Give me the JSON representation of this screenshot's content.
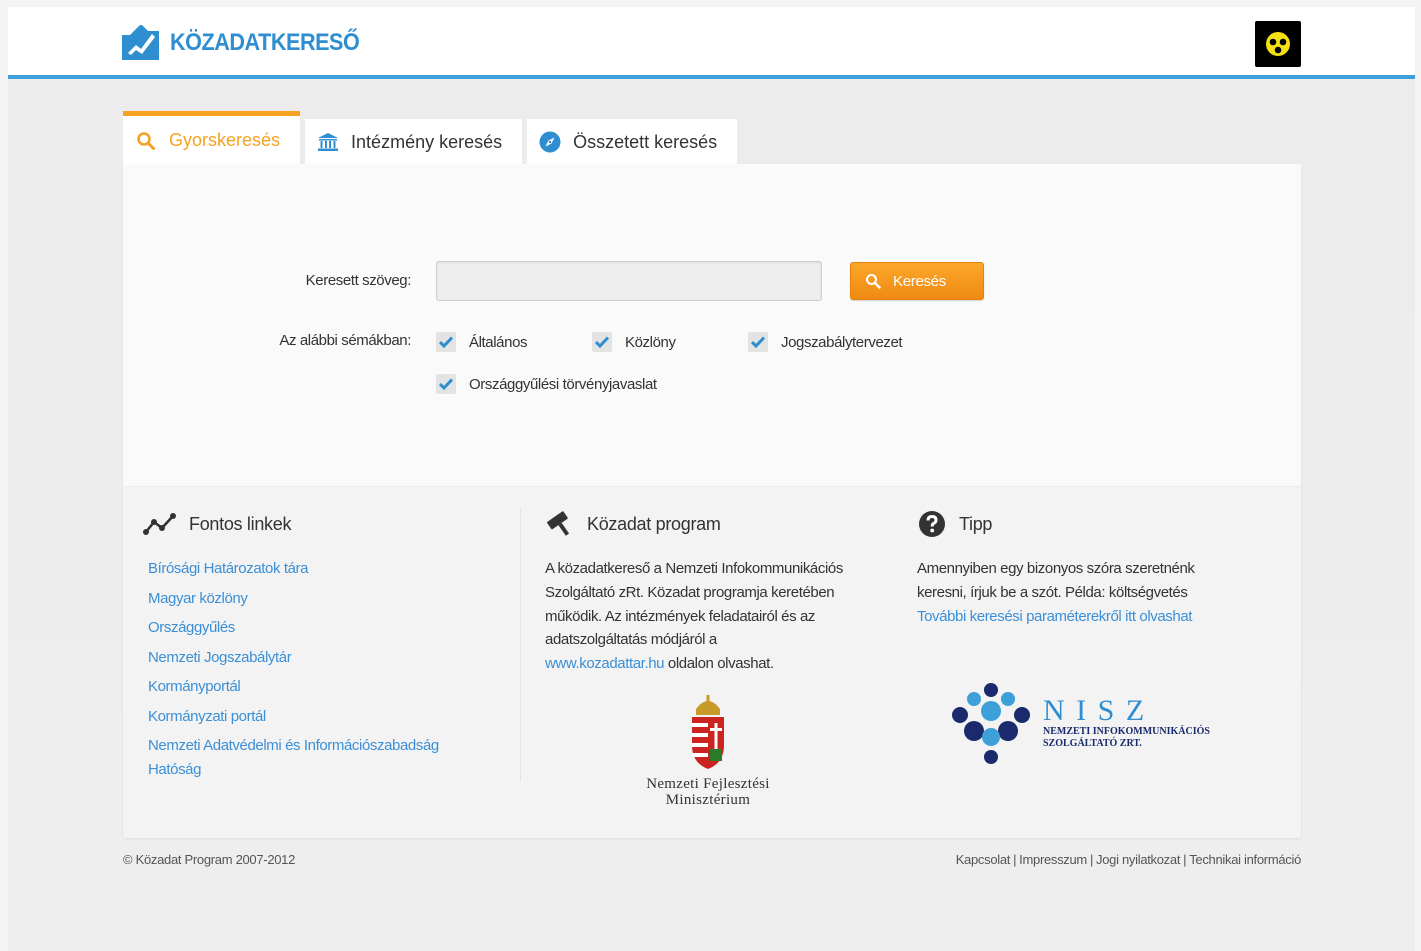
{
  "header": {
    "logo_text": "KÖZADATKERESŐ",
    "accessibility_icon": "low-vision-icon"
  },
  "tabs": [
    {
      "label": "Gyorskeresés",
      "icon": "search-icon",
      "active": true
    },
    {
      "label": "Intézmény keresés",
      "icon": "institution-icon",
      "active": false
    },
    {
      "label": "Összetett keresés",
      "icon": "compass-icon",
      "active": false
    }
  ],
  "search": {
    "text_label": "Keresett szöveg:",
    "input_value": "",
    "button_label": "Keresés",
    "schema_label": "Az alábbi sémákban:",
    "schemas": [
      {
        "label": "Általános",
        "checked": true
      },
      {
        "label": "Közlöny",
        "checked": true
      },
      {
        "label": "Jogszabálytervezet",
        "checked": true
      },
      {
        "label": "Országgyűlési törvényjavaslat",
        "checked": true
      }
    ]
  },
  "links_col": {
    "title": "Fontos linkek",
    "links": [
      "Bírósági Határozatok tára",
      "Magyar közlöny",
      "Országgyűlés",
      "Nemzeti Jogszabálytár",
      "Kormányportál",
      "Kormányzati portál",
      "Nemzeti Adatvédelmi és Információszabadság Hatóság"
    ]
  },
  "program_col": {
    "title": "Közadat program",
    "text": "A közadatkereső a Nemzeti Infokommunikációs Szolgáltató zRt. Közadat programja keretében működik. Az intézmények feladatairól és az adatszolgáltatás módjáról a",
    "link": "www.kozadattar.hu",
    "text_after": "oldalon olvashat.",
    "ministry_line1": "Nemzeti Fejlesztési",
    "ministry_line2": "Minisztérium"
  },
  "tip_col": {
    "title": "Tipp",
    "text": "Amennyiben egy bizonyos szóra szeretnénk keresni, írjuk be a szót. Példa: költségvetés",
    "link": "További keresési paraméterekről itt olvashat",
    "nisz_title": "N I S Z",
    "nisz_line1": "NEMZETI INFOKOMMUNIKÁCIÓS",
    "nisz_line2": "SZOLGÁLTATÓ ZRT."
  },
  "footer": {
    "copyright": "© Közadat Program 2007-2012",
    "links": [
      "Kapcsolat",
      "Impresszum",
      "Jogi nyilatkozat",
      "Technikai információ"
    ]
  },
  "colors": {
    "brand_blue": "#2e8ed0",
    "accent_orange": "#f7a120",
    "link_blue": "#3b8fd6"
  }
}
